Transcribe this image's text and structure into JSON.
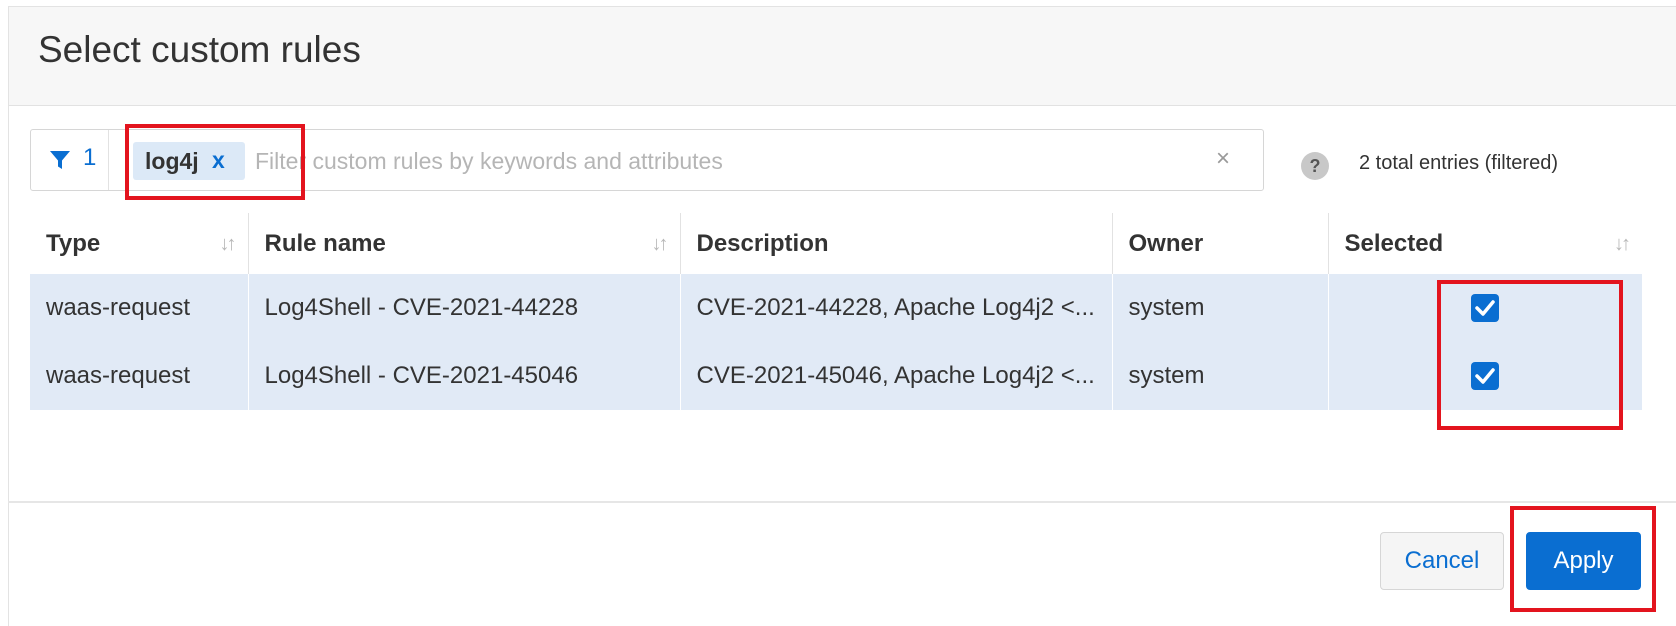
{
  "dialog": {
    "title": "Select custom rules"
  },
  "filter": {
    "active_count": "1",
    "chip_label": "log4j",
    "chip_remove": "x",
    "placeholder": "Filter custom rules by keywords and attributes",
    "clear": "×",
    "help": "?",
    "total_entries": "2 total entries (filtered)"
  },
  "table": {
    "columns": [
      "Type",
      "Rule name",
      "Description",
      "Owner",
      "Selected"
    ],
    "rows": [
      {
        "type": "waas-request",
        "rule_name": "Log4Shell - CVE-2021-44228",
        "description": "CVE-2021-44228, Apache Log4j2 <...",
        "owner": "system",
        "selected": true
      },
      {
        "type": "waas-request",
        "rule_name": "Log4Shell - CVE-2021-45046",
        "description": "CVE-2021-45046, Apache Log4j2 <...",
        "owner": "system",
        "selected": true
      }
    ]
  },
  "footer": {
    "cancel_label": "Cancel",
    "apply_label": "Apply"
  },
  "icons": {
    "filter": "funnel-icon",
    "chip_remove": "close-icon",
    "clear": "clear-icon",
    "help": "help-icon",
    "sort": "sort-icon",
    "checkbox": "checkmark-icon"
  },
  "colors": {
    "accent": "#0a6ed1",
    "selected_row": "#e1eaf6",
    "highlight": "#e3141e"
  }
}
